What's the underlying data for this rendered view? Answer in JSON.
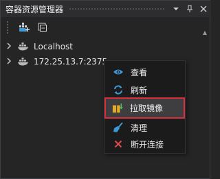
{
  "panel": {
    "title": "容器资源管理器",
    "icons": {
      "dropdown": "dropdown-arrow-icon",
      "pin": "pin-icon",
      "close": "close-icon"
    }
  },
  "toolbar": {
    "buttons": [
      {
        "name": "add-connection-icon"
      },
      {
        "name": "collapse-all-icon"
      }
    ]
  },
  "tree": {
    "nodes": [
      {
        "label": "Localhost",
        "icon": "docker-host-icon"
      },
      {
        "label": "172.25.13.7:2375",
        "icon": "docker-host-icon"
      }
    ]
  },
  "context_menu": {
    "items": [
      {
        "label": "查看",
        "icon": "eye-icon"
      },
      {
        "label": "刷新",
        "icon": "refresh-icon"
      },
      {
        "label": "拉取镜像",
        "icon": "pull-image-icon",
        "highlighted": true
      },
      {
        "label": "清理",
        "icon": "broom-icon"
      },
      {
        "label": "断开连接",
        "icon": "x-icon"
      }
    ]
  },
  "colors": {
    "background": "#252526",
    "titlebar": "#2d2d30",
    "menu_background": "#1b1b1c",
    "highlight_border": "#d9303b",
    "accent_blue": "#3c9bd6",
    "danger_red": "#e04b4b"
  }
}
